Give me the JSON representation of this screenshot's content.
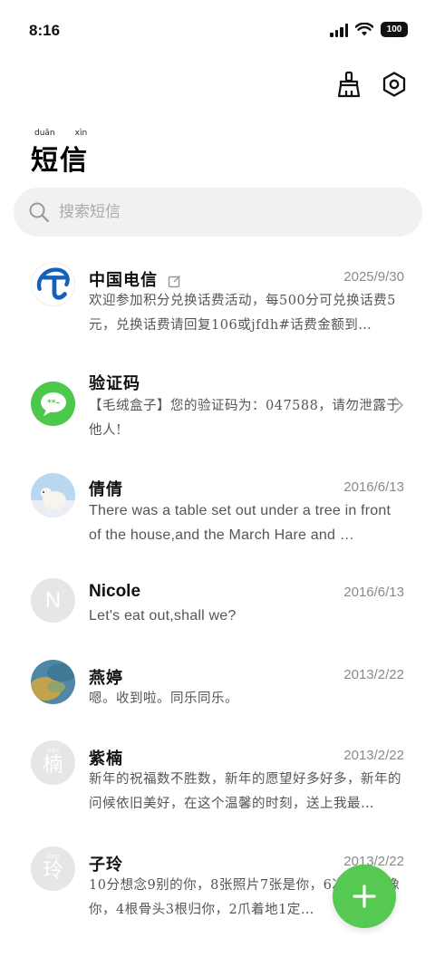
{
  "status": {
    "time": "8:16",
    "battery": "100"
  },
  "header": {
    "title": "短信",
    "title_pinyin": [
      "duǎn",
      "xìn"
    ],
    "clean_icon": "broom-icon",
    "settings_icon": "gear-icon"
  },
  "search": {
    "placeholder": "搜索短信"
  },
  "messages": [
    {
      "sender": "中国电信",
      "date": "2025/9/30",
      "preview": "欢迎参加积分兑换话费活动，每500分可兑换话费5元，兑换话费请回复106或jfdh#话费金额到…",
      "avatar": "china-telecom-logo",
      "draft_icon": "edit-icon"
    },
    {
      "sender": "验证码",
      "date": "",
      "preview": "【毛绒盒子】您的验证码为：047588，请勿泄露于他人!",
      "avatar": "message-bubble-icon",
      "accent": "#4cc84a"
    },
    {
      "sender": "倩倩",
      "date": "2016/6/13",
      "preview": "There was a table set out under a tree in front of the house,and the March Hare and …",
      "avatar": "polar-bear-photo"
    },
    {
      "sender": "Nicole",
      "date": "2016/6/13",
      "preview": "Let's eat out,shall we?",
      "avatar_letter": "N"
    },
    {
      "sender": "燕婷",
      "date": "2013/2/22",
      "preview": "嗯。收到啦。同乐同乐。",
      "avatar": "sea-photo"
    },
    {
      "sender": "紫楠",
      "date": "2013/2/22",
      "preview": "新年的祝福数不胜数，新年的愿望好多好多，新年的问候依旧美好，在这个温馨的时刻，送上我最…",
      "avatar_char": "楠",
      "avatar_pinyin": "nán"
    },
    {
      "sender": "子玲",
      "date": "2013/2/22",
      "preview": "10分想念9别的你，8张照片7张是你，6次梦里只像你，4根骨头3根归你，2爪着地1定…",
      "avatar_char": "玲",
      "avatar_pinyin": "líng"
    }
  ],
  "fab": {
    "icon": "plus-icon",
    "color": "#55c952"
  }
}
